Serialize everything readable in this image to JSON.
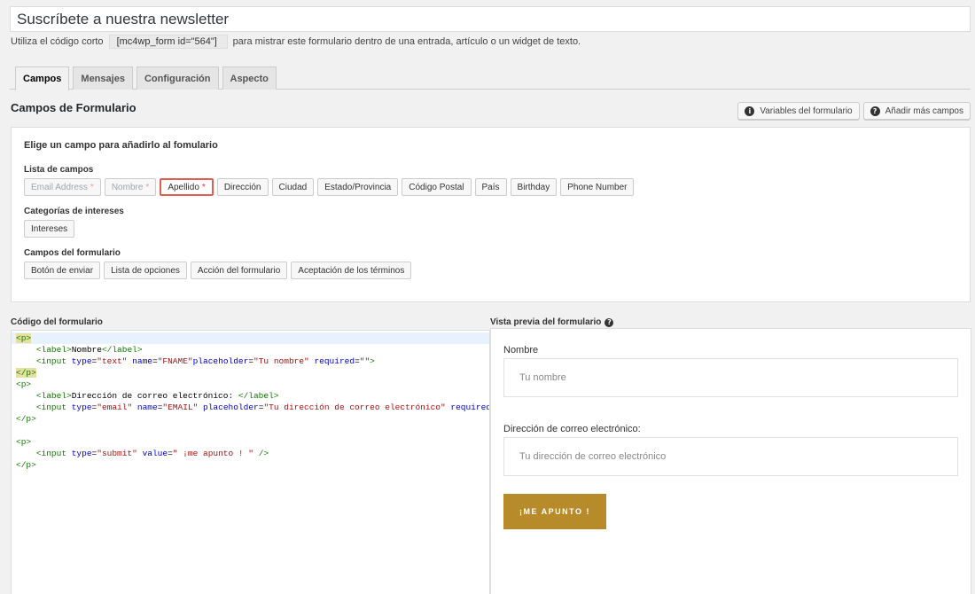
{
  "form": {
    "title": "Suscríbete a nuestra newsletter",
    "shortcode_prefix": "Utiliza el código corto",
    "shortcode": "[mc4wp_form id=\"564\"]",
    "shortcode_suffix": "para mistrar este formulario dentro de una entrada, artículo o un widget de texto."
  },
  "tabs": [
    {
      "label": "Campos",
      "active": true
    },
    {
      "label": "Mensajes",
      "active": false
    },
    {
      "label": "Configuración",
      "active": false
    },
    {
      "label": "Aspecto",
      "active": false
    }
  ],
  "section": {
    "title": "Campos de Formulario",
    "variables_btn": "Variables del formulario",
    "add_fields_btn": "Añadir más campos"
  },
  "fields_panel": {
    "heading": "Elige un campo para añadirlo al fomulario",
    "list_label": "Lista de campos",
    "list": [
      {
        "label": "Email Address",
        "required": true,
        "disabled": true
      },
      {
        "label": "Nombre",
        "required": true,
        "disabled": true
      },
      {
        "label": "Apellido",
        "required": true,
        "highlight": true
      },
      {
        "label": "Dirección"
      },
      {
        "label": "Ciudad"
      },
      {
        "label": "Estado/Provincia"
      },
      {
        "label": "Código Postal"
      },
      {
        "label": "País"
      },
      {
        "label": "Birthday"
      },
      {
        "label": "Phone Number"
      }
    ],
    "interests_label": "Categorías de intereses",
    "interests": [
      "Intereses"
    ],
    "form_fields_label": "Campos del formulario",
    "form_fields": [
      "Botón de enviar",
      "Lista de opciones",
      "Acción del formulario",
      "Aceptación de los términos"
    ]
  },
  "code": {
    "label": "Código del formulario"
  },
  "preview": {
    "label": "Vista previa del formulario",
    "name_label": "Nombre",
    "name_placeholder": "Tu nombre",
    "email_label": "Dirección de correo electrónico:",
    "email_placeholder": "Tu dirección de correo electrónico",
    "submit": "¡ME APUNTO !"
  },
  "colors": {
    "accent_submit": "#b78a2a",
    "highlight_border": "#e35d52",
    "required": "#dc3232"
  }
}
